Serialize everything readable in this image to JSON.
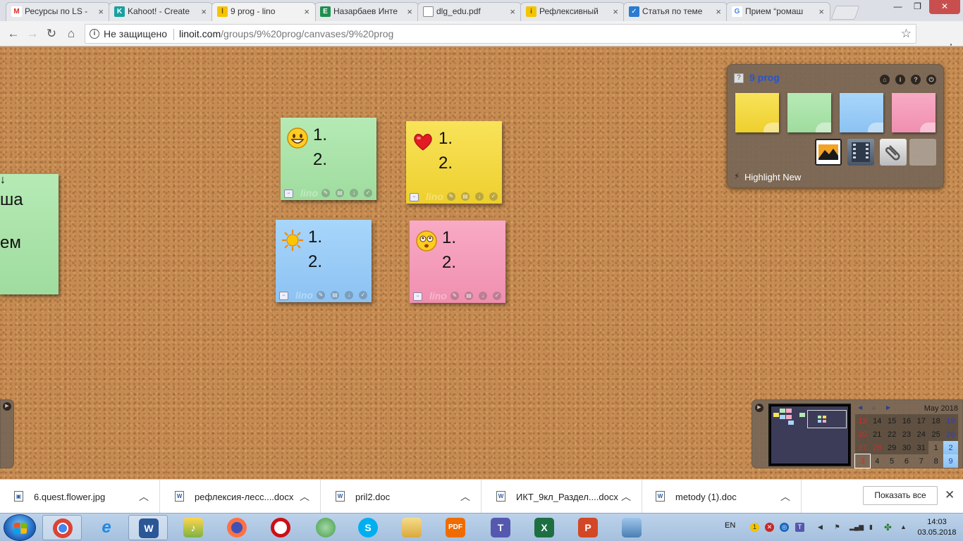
{
  "browser": {
    "tabs": [
      {
        "label": "Ресурсы по LS -",
        "favicon": "gmail-icon",
        "color": "#d93025",
        "glyph": "M"
      },
      {
        "label": "Kahoot! - Create",
        "favicon": "kahoot-icon",
        "color": "#1aa0a0",
        "glyph": "K"
      },
      {
        "label": "9 prog - lino",
        "favicon": "lino-icon",
        "color": "#f5c400",
        "glyph": "l"
      },
      {
        "label": "Назарбаев Инте",
        "favicon": "classroom-icon",
        "color": "#1f8f4e",
        "glyph": "E"
      },
      {
        "label": "dlg_edu.pdf",
        "favicon": "document-icon",
        "color": "#ffffff",
        "glyph": ""
      },
      {
        "label": "Рефлексивный",
        "favicon": "lino-icon",
        "color": "#f5c400",
        "glyph": "i"
      },
      {
        "label": "Статья по теме",
        "favicon": "checkmark-icon",
        "color": "#2b7bd1",
        "glyph": "✓"
      },
      {
        "label": "Прием “ромаш",
        "favicon": "google-icon",
        "color": "#ffffff",
        "glyph": "G"
      }
    ],
    "address": {
      "security_text": "Не защищено",
      "domain": "linoit.com",
      "path": "/groups/9%20prog/canvases/9%20prog"
    }
  },
  "board": {
    "stickies": [
      {
        "color": "green",
        "icon": "smiley-face-icon",
        "text": "1.\n2."
      },
      {
        "color": "yellow",
        "icon": "red-heart-icon",
        "text": "1.\n2."
      },
      {
        "color": "blue",
        "icon": "sun-icon",
        "text": "1.\n2."
      },
      {
        "color": "pink",
        "icon": "surprised-face-icon",
        "text": "1.\n2."
      }
    ],
    "partial_sticky_text": "ша\nем",
    "watermark": "lino"
  },
  "panel": {
    "title": "9 prog",
    "highlight_label": "Highlight New",
    "pad_colors": [
      "yellow",
      "green",
      "blue",
      "pink"
    ],
    "tools": [
      "photo-icon",
      "video-icon",
      "attachment-icon",
      "blank-sticky-icon"
    ]
  },
  "calendar": {
    "month": "May 2018",
    "weeks": [
      [
        "13",
        "14",
        "15",
        "16",
        "17",
        "18",
        "19"
      ],
      [
        "20",
        "21",
        "22",
        "23",
        "24",
        "25",
        "26"
      ],
      [
        "27",
        "28",
        "29",
        "30",
        "31",
        "1",
        "2"
      ],
      [
        "3",
        "4",
        "5",
        "6",
        "7",
        "8",
        "9"
      ]
    ]
  },
  "downloads": {
    "items": [
      {
        "name": "6.quest.flower.jpg",
        "icon": "image-file-icon"
      },
      {
        "name": "рефлексия-лесс....docx",
        "icon": "word-file-icon"
      },
      {
        "name": "pril2.doc",
        "icon": "word-file-icon"
      },
      {
        "name": "ИКТ_9кл_Раздел....docx",
        "icon": "word-file-icon"
      },
      {
        "name": "metody (1).doc",
        "icon": "word-file-icon"
      }
    ],
    "show_all_label": "Показать все"
  },
  "taskbar": {
    "apps": [
      {
        "name": "chrome-icon",
        "color": "#db4437",
        "glyph": "◉",
        "open": true
      },
      {
        "name": "internet-explorer-icon",
        "color": "#1e88e5",
        "glyph": "e",
        "open": false
      },
      {
        "name": "word-icon",
        "color": "#2b5797",
        "glyph": "W",
        "open": true
      },
      {
        "name": "music-icon",
        "color": "#7cb342",
        "glyph": "♪",
        "open": false
      },
      {
        "name": "firefox-icon",
        "color": "#e66000",
        "glyph": "●",
        "open": false
      },
      {
        "name": "opera-icon",
        "color": "#cc0f16",
        "glyph": "O",
        "open": false
      },
      {
        "name": "chat-icon",
        "color": "#43a047",
        "glyph": "◍",
        "open": false
      },
      {
        "name": "skype-icon",
        "color": "#00aff0",
        "glyph": "S",
        "open": false
      },
      {
        "name": "file-explorer-icon",
        "color": "#e8c15a",
        "glyph": "▤",
        "open": false
      },
      {
        "name": "pdf-reader-icon",
        "color": "#ef6c00",
        "glyph": "PDF",
        "open": false
      },
      {
        "name": "teams-icon",
        "color": "#5558af",
        "glyph": "T",
        "open": false
      },
      {
        "name": "excel-icon",
        "color": "#1d6f42",
        "glyph": "X",
        "open": false
      },
      {
        "name": "powerpoint-icon",
        "color": "#d24726",
        "glyph": "P",
        "open": false
      },
      {
        "name": "photo-viewer-icon",
        "color": "#4a7fb5",
        "glyph": "▣",
        "open": false
      }
    ],
    "language": "EN",
    "time": "14:03",
    "date": "03.05.2018"
  }
}
